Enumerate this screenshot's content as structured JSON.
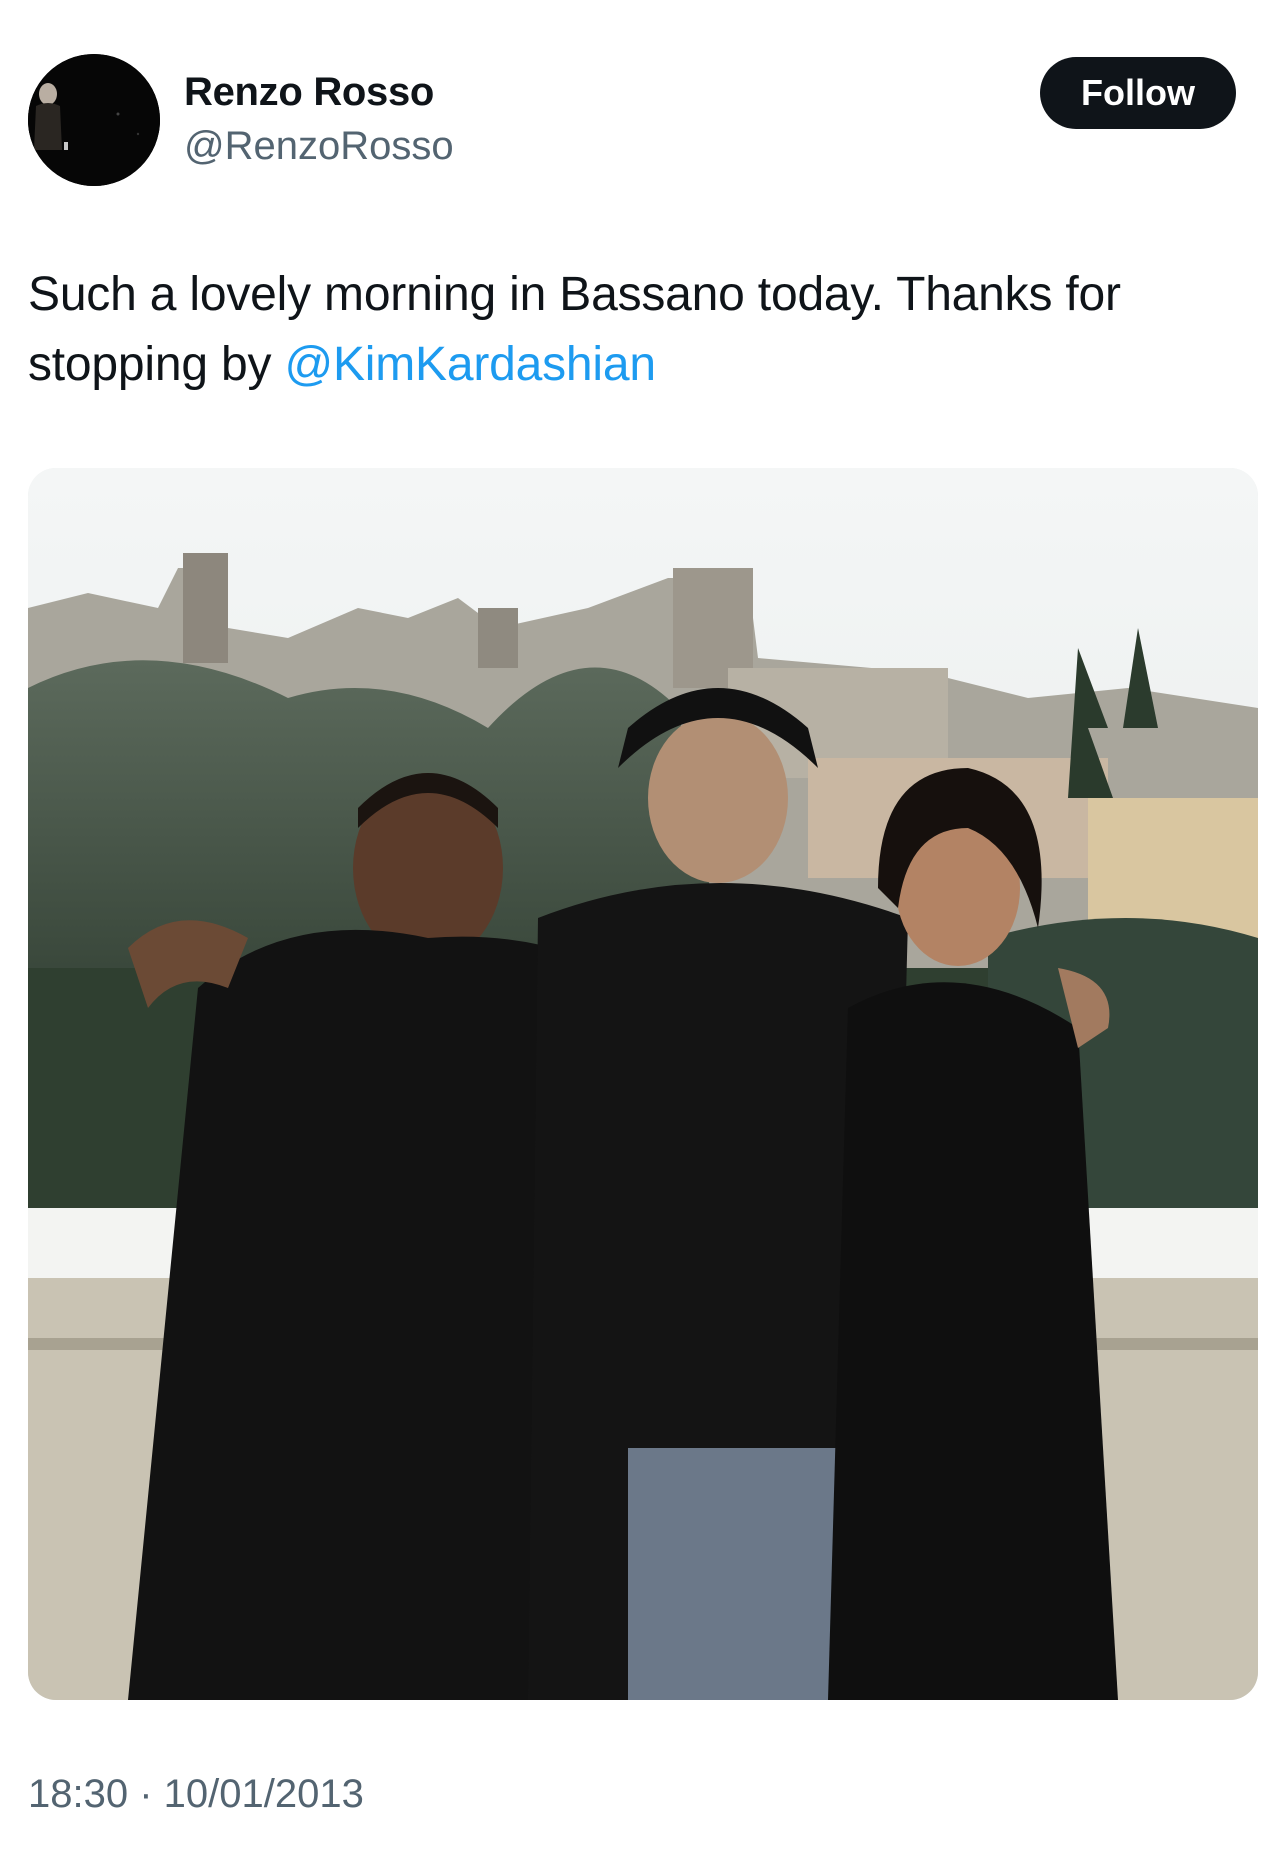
{
  "tweet": {
    "author": {
      "display_name": "Renzo Rosso",
      "handle": "@RenzoRosso",
      "avatar_icon": "profile-photo"
    },
    "follow_label": "Follow",
    "text_prefix": "Such a lovely morning in Bassano today. Thanks for stopping by ",
    "mention": "@KimKardashian",
    "timestamp": "18:30 · 10/01/2013",
    "media_icon": "photo-three-people-hilltop-town"
  },
  "colors": {
    "text_primary": "#0f1419",
    "text_secondary": "#536471",
    "link": "#1d9bf0",
    "button_bg": "#0f1419",
    "button_text": "#ffffff"
  }
}
